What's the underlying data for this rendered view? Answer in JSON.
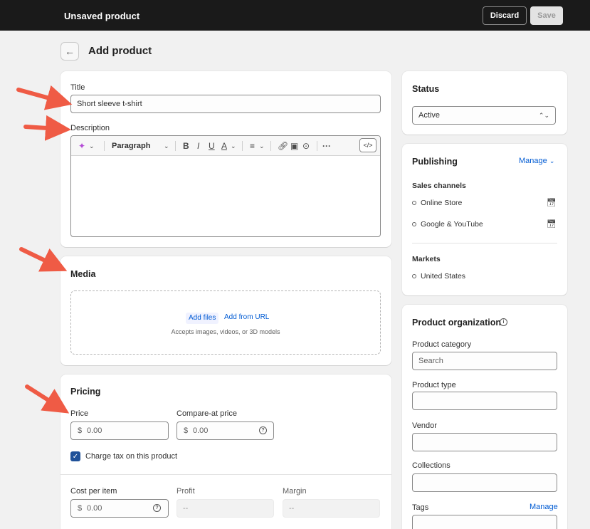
{
  "topbar": {
    "title": "Unsaved product",
    "discard_label": "Discard",
    "save_label": "Save"
  },
  "page": {
    "back_icon": "←",
    "title": "Add product"
  },
  "product_details": {
    "title_label": "Title",
    "title_value": "Short sleeve t-shirt",
    "description_label": "Description",
    "toolbar": {
      "ai_icon": "sparkle-icon",
      "paragraph_label": "Paragraph",
      "bold": "B",
      "italic": "I",
      "underline": "U",
      "color": "A",
      "more": "···",
      "code": "</>"
    }
  },
  "media": {
    "heading": "Media",
    "add_files": "Add files",
    "add_url": "Add from URL",
    "accepts_text": "Accepts images, videos, or 3D models"
  },
  "pricing": {
    "heading": "Pricing",
    "price_label": "Price",
    "price_placeholder": "0.00",
    "compare_label": "Compare-at price",
    "compare_placeholder": "0.00",
    "currency_symbol": "$",
    "charge_tax_label": "Charge tax on this product",
    "charge_tax_checked": true,
    "cost_label": "Cost per item",
    "cost_placeholder": "0.00",
    "profit_label": "Profit",
    "profit_value": "--",
    "margin_label": "Margin",
    "margin_value": "--"
  },
  "status": {
    "heading": "Status",
    "selected": "Active"
  },
  "publishing": {
    "heading": "Publishing",
    "manage_label": "Manage",
    "sales_channels_label": "Sales channels",
    "channels": [
      "Online Store",
      "Google & YouTube"
    ],
    "markets_label": "Markets",
    "markets": [
      "United States"
    ]
  },
  "organization": {
    "heading": "Product organization",
    "category_label": "Product category",
    "category_placeholder": "Search",
    "type_label": "Product type",
    "vendor_label": "Vendor",
    "collections_label": "Collections",
    "tags_label": "Tags",
    "tags_manage": "Manage"
  },
  "colors": {
    "accent_link": "#005bd3",
    "checkbox": "#1f5199",
    "annotation_arrow": "#ef5b45",
    "topbar": "#1a1a1a"
  }
}
